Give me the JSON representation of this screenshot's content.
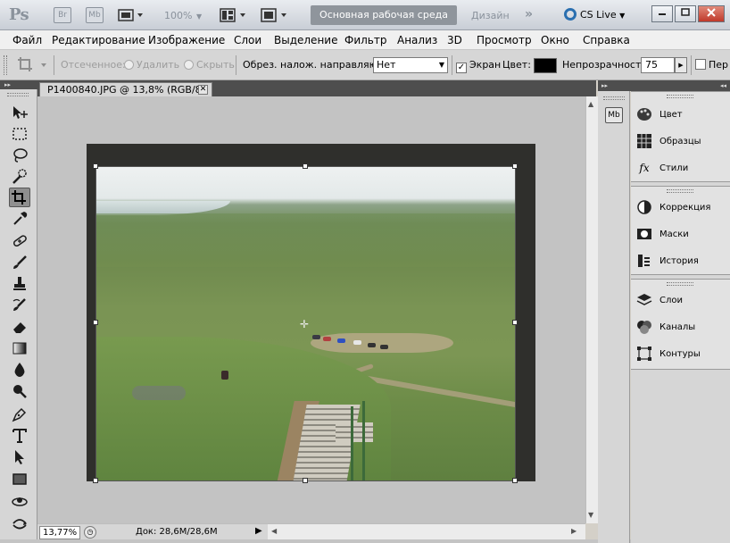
{
  "app_bar": {
    "logo": "Ps",
    "bridge": "Br",
    "mini_bridge": "Mb",
    "zoom_level": "100%",
    "workspace_active": "Основная рабочая среда",
    "workspace_other": "Дизайн",
    "more": "»",
    "cs_live": "CS Live"
  },
  "menu": [
    "Файл",
    "Редактирование",
    "Изображение",
    "Слои",
    "Выделение",
    "Фильтр",
    "Анализ",
    "3D",
    "Просмотр",
    "Окно",
    "Справка"
  ],
  "options_bar": {
    "shielded_label": "Отсеченное:",
    "delete_label": "Удалить",
    "hide_label": "Скрыть",
    "overlay_label": "Обрез. налож. направляющ.:",
    "overlay_value": "Нет",
    "screen_label": "Экран",
    "screen_checked": "✓",
    "color_label": "Цвет:",
    "shield_color": "#000000",
    "opacity_label": "Непрозрачность:",
    "opacity_value": "75",
    "perspective_label": "Пер"
  },
  "document": {
    "tab_title": "P1400840.JPG @ 13,8% (RGB/8)",
    "close": "✕",
    "status_zoom": "13,77%",
    "status_doc": "Док: 28,6M/28,6M"
  },
  "panels": {
    "group1": [
      "Цвет",
      "Образцы",
      "Стили"
    ],
    "group2": [
      "Коррекция",
      "Маски",
      "История"
    ],
    "group3": [
      "Слои",
      "Каналы",
      "Контуры"
    ]
  },
  "icons": {
    "move": "move-icon",
    "marquee": "marquee-icon",
    "lasso": "lasso-icon",
    "quick_select": "quick-select-icon",
    "crop": "crop-icon",
    "eyedropper": "eyedropper-icon",
    "healing": "healing-brush-icon",
    "brush": "brush-icon",
    "stamp": "clone-stamp-icon",
    "history_brush": "history-brush-icon",
    "eraser": "eraser-icon",
    "gradient": "gradient-icon",
    "blur": "blur-icon",
    "dodge": "dodge-icon",
    "pen": "pen-icon",
    "type": "type-icon",
    "path_select": "path-selection-icon",
    "shape": "rectangle-icon",
    "hand3d": "3d-rotate-icon",
    "orbit3d": "3d-orbit-icon"
  },
  "colors": {
    "accent_ws": "#8f959c",
    "cs_live_ring": "#2a6fb0",
    "close_button": "#c0392b"
  }
}
